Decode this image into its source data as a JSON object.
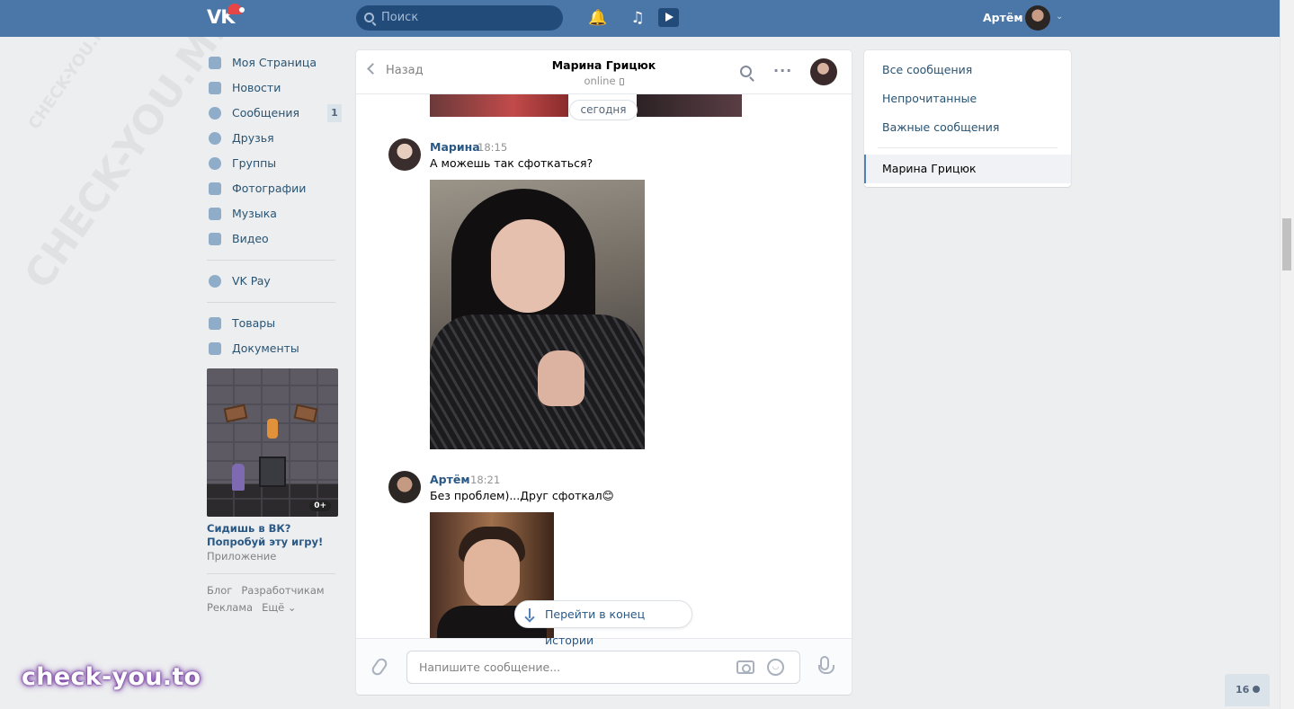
{
  "header": {
    "logo": "VK",
    "search_placeholder": "Поиск",
    "user_name": "Артём"
  },
  "sidebar": {
    "items": [
      {
        "label": "Моя Страница",
        "icon": "home-icon"
      },
      {
        "label": "Новости",
        "icon": "news-icon"
      },
      {
        "label": "Сообщения",
        "icon": "messages-icon",
        "badge": "1"
      },
      {
        "label": "Друзья",
        "icon": "friends-icon"
      },
      {
        "label": "Группы",
        "icon": "groups-icon"
      },
      {
        "label": "Фотографии",
        "icon": "camera-icon"
      },
      {
        "label": "Музыка",
        "icon": "music-icon"
      },
      {
        "label": "Видео",
        "icon": "video-icon"
      }
    ],
    "pay": {
      "label": "VK Pay",
      "icon": "vkpay-icon"
    },
    "extra": [
      {
        "label": "Товары",
        "icon": "shopping-bag-icon"
      },
      {
        "label": "Документы",
        "icon": "document-icon"
      }
    ],
    "ad": {
      "title": "Сидишь в ВК? Попробуй эту игру!",
      "subtitle": "Приложение",
      "age_badge": "0+"
    },
    "footer_links": [
      "Блог",
      "Разработчикам",
      "Реклама",
      "Ещё ⌄"
    ]
  },
  "chat": {
    "back_label": "Назад",
    "peer_name": "Марина Грицюк",
    "peer_status": "online",
    "date_divider": "сегодня",
    "messages": [
      {
        "author": "Марина",
        "time": "18:15",
        "text": "А можешь так сфоткаться?"
      },
      {
        "author": "Артём",
        "time": "18:21",
        "text": "Без проблем)...Друг сфоткал😊"
      }
    ],
    "jump_label": "Перейти в конец истории",
    "composer_placeholder": "Напишите сообщение..."
  },
  "right_panel": {
    "items": [
      "Все сообщения",
      "Непрочитанные",
      "Важные сообщения"
    ],
    "active": "Марина Грицюк"
  },
  "online_count": "16",
  "watermark": {
    "bottom": "check-you.to",
    "diagonal": "CHECK-YOU.ME"
  },
  "colors": {
    "header": "#4a76a8",
    "link": "#2a5885",
    "background": "#edeef0"
  }
}
